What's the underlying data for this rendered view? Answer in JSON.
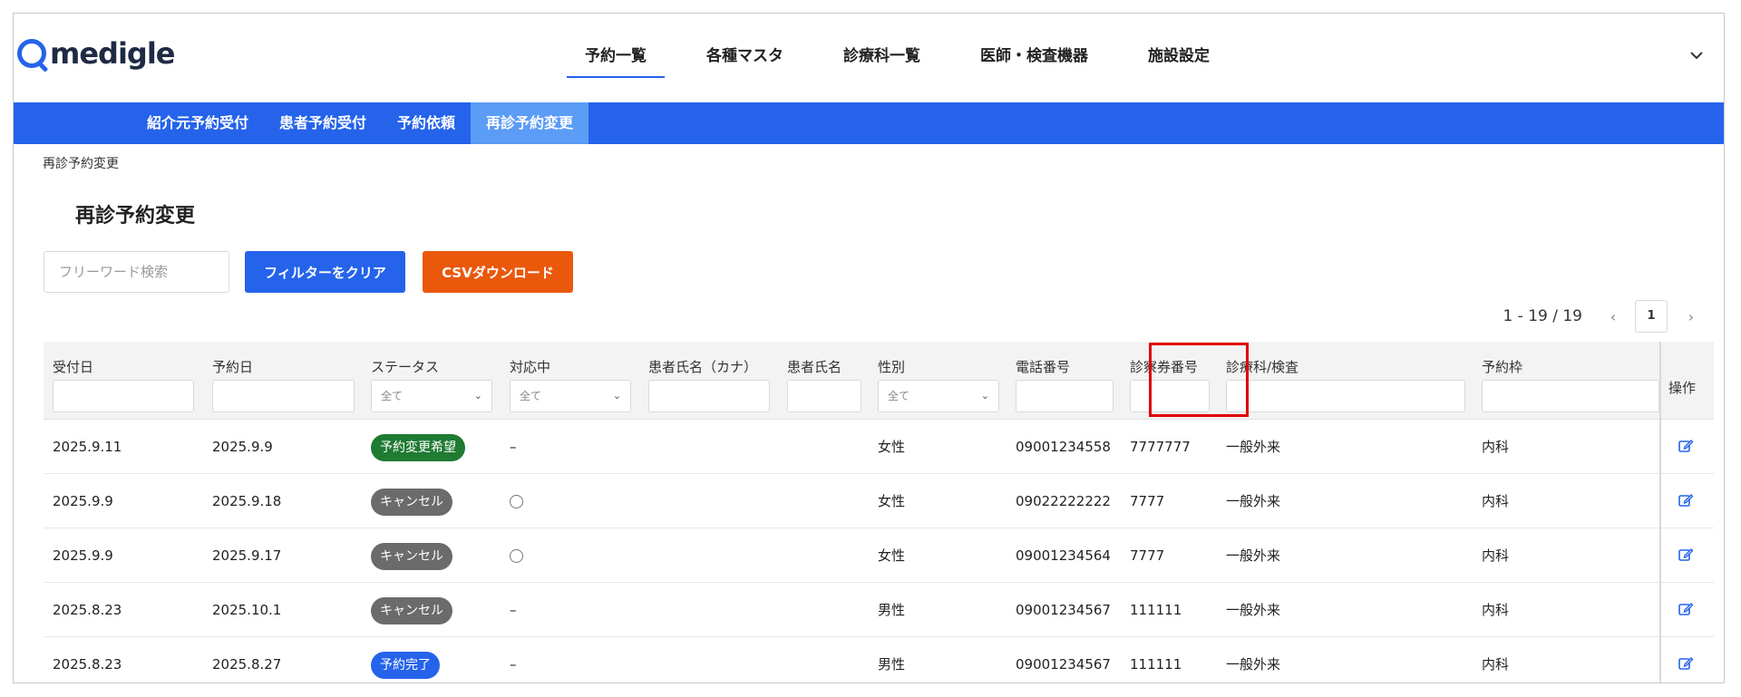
{
  "app": {
    "logo_text": "medigle"
  },
  "main_nav": [
    {
      "label": "予約一覧"
    },
    {
      "label": "各種マスタ"
    },
    {
      "label": "診療科一覧"
    },
    {
      "label": "医師・検査機器"
    },
    {
      "label": "施設設定"
    }
  ],
  "sub_nav": [
    {
      "label": "紹介元予約受付"
    },
    {
      "label": "患者予約受付"
    },
    {
      "label": "予約依頼"
    },
    {
      "label": "再診予約変更"
    }
  ],
  "breadcrumb": "再診予約変更",
  "page_title": "再診予約変更",
  "search": {
    "placeholder": "フリーワード検索"
  },
  "buttons": {
    "clear_filter": "フィルターをクリア",
    "csv_download": "CSVダウンロード"
  },
  "pager": {
    "range": "1 - 19 / 19",
    "current_page": "1"
  },
  "table": {
    "columns": [
      {
        "label": "受付日"
      },
      {
        "label": "予約日"
      },
      {
        "label": "ステータス",
        "filter": "全て"
      },
      {
        "label": "対応中",
        "filter": "全て"
      },
      {
        "label": "患者氏名（カナ）"
      },
      {
        "label": "患者氏名"
      },
      {
        "label": "性別",
        "filter": "全て"
      },
      {
        "label": "電話番号"
      },
      {
        "label": "診察券番号"
      },
      {
        "label": "診療科/検査"
      },
      {
        "label": "予約枠"
      }
    ],
    "op_header": "操作",
    "rows": [
      {
        "received": "2025.9.11",
        "reserved": "2025.9.9",
        "status": "予約変更希望",
        "status_color": "#1f7a32",
        "in_progress": "–",
        "kana": "",
        "name": "",
        "gender": "女性",
        "phone": "09001234558",
        "card_no": "7777777",
        "dept": "一般外来",
        "slot": "内科"
      },
      {
        "received": "2025.9.9",
        "reserved": "2025.9.18",
        "status": "キャンセル",
        "status_color": "#6b6b6b",
        "in_progress": "○",
        "kana": "",
        "name": "",
        "gender": "女性",
        "phone": "09022222222",
        "card_no": "7777",
        "dept": "一般外来",
        "slot": "内科"
      },
      {
        "received": "2025.9.9",
        "reserved": "2025.9.17",
        "status": "キャンセル",
        "status_color": "#6b6b6b",
        "in_progress": "○",
        "kana": "",
        "name": "",
        "gender": "女性",
        "phone": "09001234564",
        "card_no": "7777",
        "dept": "一般外来",
        "slot": "内科"
      },
      {
        "received": "2025.8.23",
        "reserved": "2025.10.1",
        "status": "キャンセル",
        "status_color": "#6b6b6b",
        "in_progress": "–",
        "kana": "",
        "name": "",
        "gender": "男性",
        "phone": "09001234567",
        "card_no": "111111",
        "dept": "一般外来",
        "slot": "内科"
      },
      {
        "received": "2025.8.23",
        "reserved": "2025.8.27",
        "status": "予約完了",
        "status_color": "#2563eb",
        "in_progress": "–",
        "kana": "",
        "name": "",
        "gender": "男性",
        "phone": "09001234567",
        "card_no": "111111",
        "dept": "一般外来",
        "slot": "内科"
      }
    ]
  },
  "colors": {
    "primary": "#2563eb",
    "subnav_active": "#5b9cf6",
    "csv_button": "#ea580c",
    "highlight_border": "#e00000"
  }
}
